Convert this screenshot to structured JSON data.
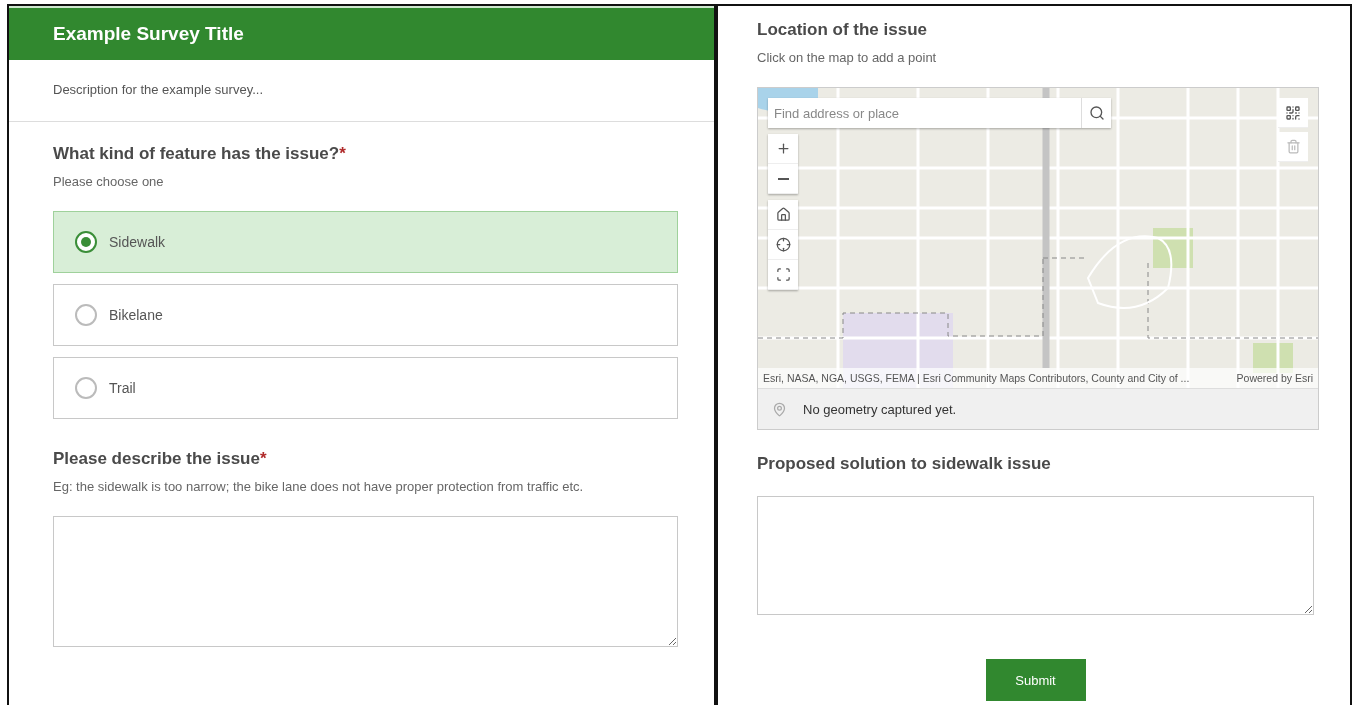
{
  "left_panel": {
    "header": {
      "title": "Example Survey Title"
    },
    "description": "Description for the example survey...",
    "questions": [
      {
        "kind": "choice",
        "label": "What kind of feature has the issue?",
        "required_mark": "*",
        "hint": "Please choose one",
        "options": [
          {
            "label": "Sidewalk",
            "selected": true
          },
          {
            "label": "Bikelane",
            "selected": false
          },
          {
            "label": "Trail",
            "selected": false
          }
        ]
      },
      {
        "kind": "text",
        "label": "Please describe the issue",
        "required_mark": "*",
        "hint": "Eg: the sidewalk is too narrow; the bike lane does not have proper protection from traffic etc."
      }
    ]
  },
  "right_panel": {
    "questions": [
      {
        "kind": "map",
        "label": "Location of the issue",
        "hint": "Click on the map to add a point",
        "search_placeholder": "Find address or place",
        "attribution": "Esri, NASA, NGA, USGS, FEMA | Esri Community Maps Contributors, County and City of ...",
        "powered_by": "Powered by Esri",
        "status": "No geometry captured yet."
      },
      {
        "kind": "text",
        "label": "Proposed solution to sidewalk issue"
      }
    ],
    "submit": "Submit"
  }
}
